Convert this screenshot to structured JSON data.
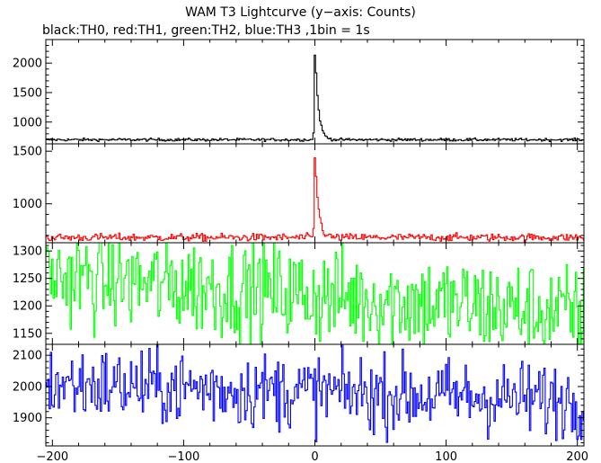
{
  "title": "WAM T3 Lightcurve (y−axis: Counts)",
  "subtitle": "black:TH0, red:TH1, green:TH2, blue:TH3 ,1bin = 1s",
  "chart_data": {
    "type": "line",
    "x_range": [
      -205,
      205
    ],
    "x_ticks": [
      -200,
      -100,
      0,
      100,
      200
    ],
    "x_tick_labels": [
      "−200",
      "−100",
      "0",
      "100",
      "200"
    ],
    "bin_seconds": 1,
    "grid": false,
    "panels": [
      {
        "name": "TH0",
        "color": "#000000",
        "ylim": [
          630,
          2400
        ],
        "y_ticks": [
          1000,
          1500,
          2000
        ],
        "y_tick_labels": [
          "1000",
          "1500",
          "2000"
        ],
        "baseline": 700,
        "noise": 12,
        "burst": {
          "start": 0,
          "peak": 2380,
          "decay": 2.5
        }
      },
      {
        "name": "TH1",
        "color": "#ff0000",
        "ylim": [
          630,
          1570
        ],
        "y_ticks": [
          1000,
          1500
        ],
        "y_tick_labels": [
          "1000",
          "1500"
        ],
        "baseline": 680,
        "noise": 18,
        "burst": {
          "start": 0,
          "peak": 1560,
          "decay": 2.5
        }
      },
      {
        "name": "TH2",
        "color": "#00ff00",
        "ylim": [
          1130,
          1315
        ],
        "y_ticks": [
          1150,
          1200,
          1250,
          1300
        ],
        "y_tick_labels": [
          "1150",
          "1200",
          "1250",
          "1300"
        ],
        "baseline_start": 1255,
        "baseline_end": 1185,
        "noise": 45
      },
      {
        "name": "TH3",
        "color": "#0000ff",
        "ylim": [
          1810,
          2135
        ],
        "y_ticks": [
          1900,
          2000,
          2100
        ],
        "y_tick_labels": [
          "1900",
          "2000",
          "2100"
        ],
        "baseline_start": 2010,
        "baseline_end": 1955,
        "noise": 60
      }
    ]
  }
}
